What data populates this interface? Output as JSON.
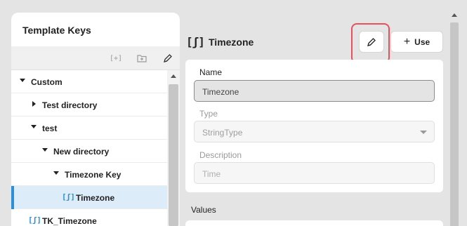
{
  "left_panel": {
    "title": "Template Keys",
    "toolbar": {
      "add_key_icon": "[+]",
      "add_folder_icon": "folder-plus-icon",
      "edit_icon": "pencil-icon"
    },
    "tree": [
      {
        "label": "Custom",
        "state": "expanded"
      },
      {
        "label": "Test directory",
        "state": "collapsed"
      },
      {
        "label": "test",
        "state": "expanded"
      },
      {
        "label": "New directory",
        "state": "expanded"
      },
      {
        "label": "Timezone Key",
        "state": "expanded"
      },
      {
        "label": "Timezone",
        "icon": "[ʃ]",
        "selected": true
      },
      {
        "label": "TK_Timezone",
        "icon": "[ʃ]"
      }
    ]
  },
  "detail": {
    "icon": "[ʃ]",
    "title": "Timezone",
    "edit_icon": "pencil-icon",
    "use_button": {
      "icon": "+",
      "label": "Use"
    },
    "fields": {
      "name": {
        "label": "Name",
        "value": "Timezone"
      },
      "type": {
        "label": "Type",
        "value": "StringType"
      },
      "description": {
        "label": "Description",
        "placeholder": "Time"
      }
    },
    "values_label": "Values"
  },
  "colors": {
    "accent": "#2d8fd5",
    "selection_bg": "#dcecf8",
    "highlight": "#e8505b"
  }
}
